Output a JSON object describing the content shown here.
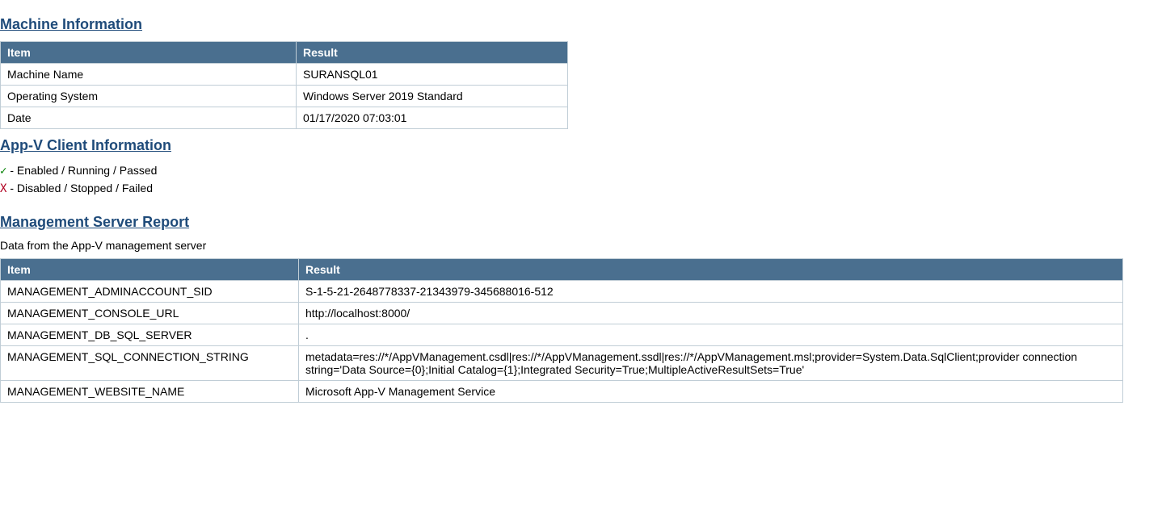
{
  "sections": {
    "machine": {
      "heading": "Machine Information",
      "headers": {
        "item": "Item",
        "result": "Result"
      },
      "rows": [
        {
          "item": "Machine Name",
          "result": "SURANSQL01"
        },
        {
          "item": "Operating System",
          "result": "Windows Server 2019 Standard"
        },
        {
          "item": "Date",
          "result": "01/17/2020 07:03:01"
        }
      ]
    },
    "appv_client": {
      "heading": "App-V Client Information",
      "legend": {
        "pass_symbol": "✓",
        "pass_text": " - Enabled / Running / Passed",
        "fail_symbol": "X",
        "fail_text": " - Disabled / Stopped / Failed"
      }
    },
    "mgmt": {
      "heading": "Management Server Report",
      "subtext": "Data from the App-V management server",
      "headers": {
        "item": "Item",
        "result": "Result"
      },
      "rows": [
        {
          "item": "MANAGEMENT_ADMINACCOUNT_SID",
          "result": "S-1-5-21-2648778337-21343979-345688016-512"
        },
        {
          "item": "MANAGEMENT_CONSOLE_URL",
          "result": "http://localhost:8000/"
        },
        {
          "item": "MANAGEMENT_DB_SQL_SERVER",
          "result": "."
        },
        {
          "item": "MANAGEMENT_SQL_CONNECTION_STRING",
          "result": "metadata=res://*/AppVManagement.csdl|res://*/AppVManagement.ssdl|res://*/AppVManagement.msl;provider=System.Data.SqlClient;provider connection string='Data Source={0};Initial Catalog={1};Integrated Security=True;MultipleActiveResultSets=True'"
        },
        {
          "item": "MANAGEMENT_WEBSITE_NAME",
          "result": "Microsoft App-V Management Service"
        }
      ]
    }
  }
}
